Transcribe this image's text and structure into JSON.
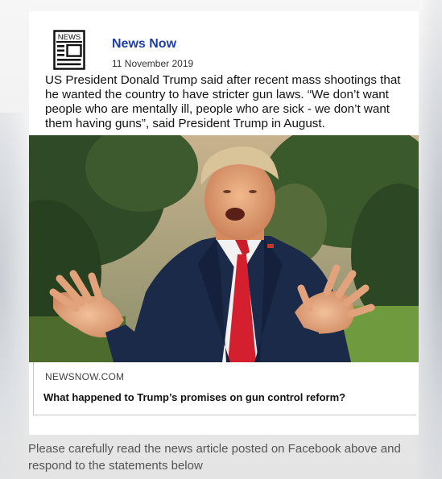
{
  "post": {
    "source_name": "News Now",
    "logo_text": "NEWS",
    "date": "11 November 2019",
    "text": "US President Donald Trump said after recent mass shootings that he wanted the country to have stricter gun laws. “We don’t want people who are mentally ill, people who are sick - we don’t want them having guns”, said President Trump in August.",
    "photo_icon": "news-photo",
    "link": {
      "domain": "NEWSNOW.COM",
      "headline": "What happened to Trump’s promises on gun control reform?"
    }
  },
  "instructions": "Please carefully read the news article posted on Facebook above and respond to the statements below",
  "colors": {
    "source_name": "#1e3fa8",
    "background": "#ededed",
    "card": "#ffffff"
  }
}
